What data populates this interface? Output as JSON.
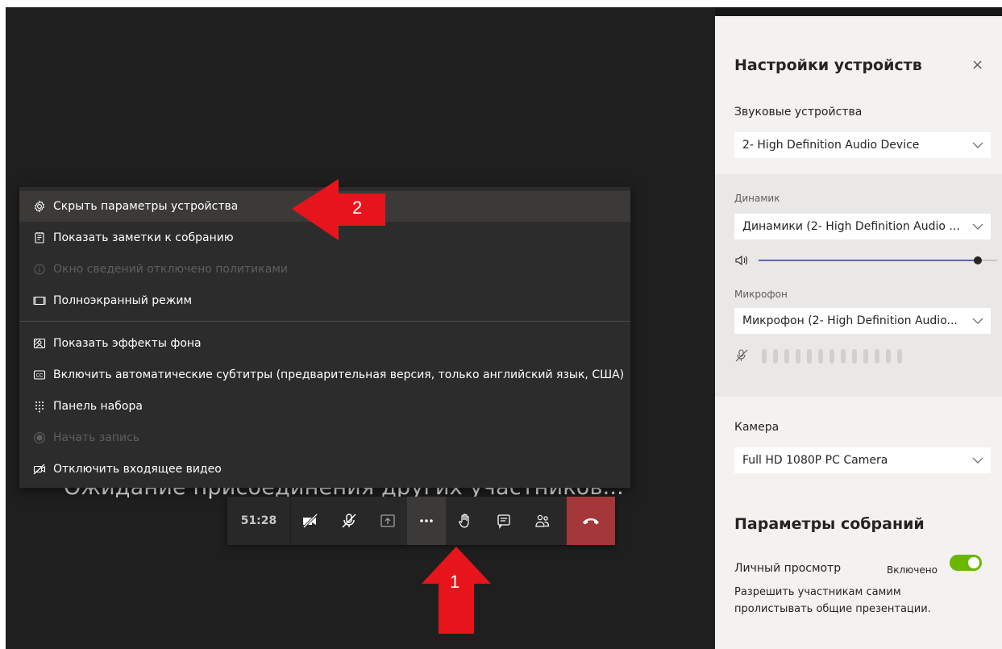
{
  "stage": {
    "waiting_text": "Ожидание присоединения других участников..."
  },
  "menu": {
    "items": [
      {
        "label": "Скрыть параметры устройства",
        "icon": "gear-icon",
        "highlighted": true,
        "disabled": false
      },
      {
        "label": "Показать заметки к собранию",
        "icon": "notes-icon",
        "disabled": false
      },
      {
        "label": "Окно сведений отключено политиками",
        "icon": "info-icon",
        "disabled": true
      },
      {
        "label": "Полноэкранный режим",
        "icon": "fullscreen-icon",
        "disabled": false
      },
      {
        "label": "Показать эффекты фона",
        "icon": "background-effects-icon",
        "disabled": false
      },
      {
        "label": "Включить автоматические субтитры (предварительная версия, только английский язык, США)",
        "icon": "captions-icon",
        "disabled": false
      },
      {
        "label": "Панель набора",
        "icon": "dialpad-icon",
        "disabled": false
      },
      {
        "label": "Начать запись",
        "icon": "record-icon",
        "disabled": true
      },
      {
        "label": "Отключить входящее видео",
        "icon": "video-off-icon",
        "disabled": false
      }
    ]
  },
  "callbar": {
    "timer": "51:28"
  },
  "annotations": {
    "arrow1": "1",
    "arrow2": "2",
    "color": "#e8141b"
  },
  "panel": {
    "title": "Настройки устройств",
    "close": "×",
    "audio_devices_label": "Звуковые устройства",
    "audio_device_value": "2- High Definition Audio Device",
    "speaker_label": "Динамик",
    "speaker_value": "Динамики (2- High Definition Audio ...",
    "speaker_volume": 0.92,
    "mic_label": "Микрофон",
    "mic_value": "Микрофон (2- High Definition Audio...",
    "camera_label": "Камера",
    "camera_value": "Full HD 1080P PC Camera",
    "meeting_title": "Параметры собраний",
    "private_view_label": "Личный просмотр",
    "private_view_state": "Включено",
    "private_view_desc_1": "Разрешить участникам самим",
    "private_view_desc_2": "пролистывать общие презентации.",
    "toggle_color": "#6bb700"
  }
}
